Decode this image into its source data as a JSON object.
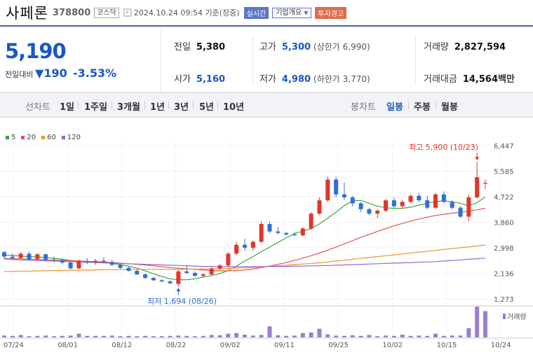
{
  "header": {
    "name": "사페론",
    "code": "378800",
    "market": "코스닥",
    "datetime": "2024.10.24 09:54 기준(장중)",
    "badge_realtime": "실시간",
    "badge_company": "기업개요",
    "badge_warning": "투자경고"
  },
  "price": {
    "current": "5,190",
    "change_label": "전일대비",
    "change_amount": "190",
    "change_pct": "-3.53%",
    "color_down": "#1a56c8",
    "color_up": "#e0362c"
  },
  "stats": {
    "prev_label": "전일",
    "prev": "5,380",
    "open_label": "시가",
    "open": "5,160",
    "high_label": "고가",
    "high": "5,300",
    "upper_limit": "(상한가 6,990)",
    "low_label": "저가",
    "low": "4,980",
    "lower_limit": "(하한가 3,770)",
    "volume_label": "거래량",
    "volume": "2,827,594",
    "amount_label": "거래대금",
    "amount": "14,564",
    "amount_unit": "백만"
  },
  "toolbar": {
    "line_label": "선차트",
    "line_periods": [
      "1일",
      "1주일",
      "3개월",
      "1년",
      "3년",
      "5년",
      "10년"
    ],
    "candle_label": "봉차트",
    "candle_periods": [
      "일봉",
      "주봉",
      "월봉"
    ],
    "active_candle": "일봉"
  },
  "chart_data": {
    "type": "candlestick",
    "legend": [
      {
        "name": "5",
        "color": "#3fa53f"
      },
      {
        "name": "20",
        "color": "#e05555"
      },
      {
        "name": "60",
        "color": "#e8962e"
      },
      {
        "name": "120",
        "color": "#9966cc"
      }
    ],
    "y_ticks": [
      "6,447",
      "5,585",
      "4,722",
      "3,860",
      "2,998",
      "2,136",
      "1,273"
    ],
    "x_ticks": [
      "07/24",
      "08/01",
      "08/12",
      "08/22",
      "09/02",
      "09/11",
      "09/25",
      "10/02",
      "10/15",
      "10/24"
    ],
    "annotation_high": "최고 5,900 (10/23)",
    "annotation_low": "최저 1,694 (08/26)",
    "volume_label": "거래량",
    "candles": [
      [
        2850,
        2900,
        2620,
        2700
      ],
      [
        2700,
        2800,
        2600,
        2650
      ],
      [
        2650,
        2850,
        2620,
        2800
      ],
      [
        2800,
        2860,
        2560,
        2620
      ],
      [
        2620,
        2820,
        2580,
        2780
      ],
      [
        2780,
        2800,
        2560,
        2600
      ],
      [
        2600,
        2700,
        2500,
        2580
      ],
      [
        2580,
        2650,
        2450,
        2500
      ],
      [
        2500,
        2550,
        2280,
        2300
      ],
      [
        2300,
        2600,
        2280,
        2550
      ],
      [
        2550,
        2650,
        2450,
        2500
      ],
      [
        2500,
        2620,
        2420,
        2560
      ],
      [
        2560,
        2680,
        2480,
        2520
      ],
      [
        2520,
        2600,
        2380,
        2420
      ],
      [
        2420,
        2460,
        2280,
        2320
      ],
      [
        2320,
        2360,
        2200,
        2220
      ],
      [
        2220,
        2260,
        2080,
        2100
      ],
      [
        2100,
        2140,
        1950,
        1980
      ],
      [
        1980,
        2020,
        1880,
        1900
      ],
      [
        1900,
        1940,
        1840,
        1860
      ],
      [
        1860,
        1900,
        1780,
        1800
      ],
      [
        1780,
        2250,
        1694,
        2200
      ],
      [
        2200,
        2400,
        2100,
        2150
      ],
      [
        2150,
        2200,
        2020,
        2050
      ],
      [
        2050,
        2150,
        1980,
        2100
      ],
      [
        2100,
        2350,
        2050,
        2300
      ],
      [
        2300,
        2450,
        2250,
        2400
      ],
      [
        2400,
        2850,
        2350,
        2800
      ],
      [
        2800,
        3200,
        2750,
        3100
      ],
      [
        3100,
        3300,
        2900,
        3000
      ],
      [
        3000,
        3250,
        2900,
        3200
      ],
      [
        3200,
        3900,
        3150,
        3800
      ],
      [
        3800,
        3880,
        3500,
        3550
      ],
      [
        3550,
        3700,
        3450,
        3500
      ],
      [
        3500,
        3520,
        3400,
        3450
      ],
      [
        3450,
        3520,
        3380,
        3420
      ],
      [
        3420,
        3700,
        3380,
        3650
      ],
      [
        3650,
        4200,
        3600,
        4150
      ],
      [
        4150,
        4700,
        4100,
        4600
      ],
      [
        4600,
        5400,
        4550,
        5300
      ],
      [
        5300,
        5400,
        4700,
        4800
      ],
      [
        4800,
        5200,
        4600,
        4700
      ],
      [
        4700,
        4750,
        4400,
        4500
      ],
      [
        4500,
        4550,
        4200,
        4300
      ],
      [
        4300,
        4350,
        4100,
        4150
      ],
      [
        4150,
        4300,
        4000,
        4250
      ],
      [
        4250,
        4650,
        4200,
        4600
      ],
      [
        4600,
        4700,
        4350,
        4400
      ],
      [
        4400,
        4600,
        4350,
        4550
      ],
      [
        4550,
        4800,
        4500,
        4750
      ],
      [
        4750,
        4850,
        4550,
        4600
      ],
      [
        4600,
        4750,
        4300,
        4350
      ],
      [
        4350,
        4850,
        4300,
        4800
      ],
      [
        4800,
        4900,
        4500,
        4550
      ],
      [
        4550,
        4600,
        4300,
        4350
      ],
      [
        4350,
        4400,
        4000,
        4050
      ],
      [
        4050,
        4800,
        3900,
        4700
      ],
      [
        4700,
        5900,
        4650,
        5380
      ],
      [
        5160,
        5300,
        4980,
        5190
      ]
    ],
    "ma5": [
      2750,
      2740,
      2720,
      2700,
      2690,
      2670,
      2640,
      2610,
      2570,
      2550,
      2530,
      2520,
      2500,
      2470,
      2430,
      2380,
      2310,
      2220,
      2120,
      2030,
      1950,
      1920,
      1920,
      1950,
      2010,
      2060,
      2130,
      2230,
      2380,
      2550,
      2700,
      2870,
      3020,
      3180,
      3330,
      3480,
      3560,
      3650,
      3800,
      4000,
      4200,
      4420,
      4580,
      4600,
      4500,
      4400,
      4350,
      4330,
      4330,
      4370,
      4440,
      4500,
      4560,
      4580,
      4550,
      4500,
      4420,
      4520,
      4720
    ],
    "ma20": [
      2640,
      2630,
      2620,
      2610,
      2600,
      2590,
      2580,
      2570,
      2560,
      2550,
      2540,
      2530,
      2520,
      2500,
      2480,
      2460,
      2440,
      2420,
      2390,
      2360,
      2330,
      2310,
      2290,
      2270,
      2250,
      2230,
      2220,
      2220,
      2230,
      2250,
      2280,
      2330,
      2380,
      2440,
      2500,
      2570,
      2650,
      2730,
      2820,
      2920,
      3020,
      3130,
      3240,
      3350,
      3450,
      3550,
      3650,
      3740,
      3820,
      3900,
      3970,
      4030,
      4090,
      4130,
      4170,
      4200,
      4230,
      4280,
      4330
    ],
    "ma60": [
      2200,
      2200,
      2210,
      2210,
      2220,
      2220,
      2230,
      2230,
      2240,
      2240,
      2250,
      2250,
      2260,
      2260,
      2260,
      2270,
      2270,
      2270,
      2270,
      2270,
      2270,
      2270,
      2280,
      2280,
      2280,
      2290,
      2290,
      2300,
      2310,
      2320,
      2330,
      2350,
      2370,
      2390,
      2410,
      2430,
      2450,
      2470,
      2490,
      2520,
      2550,
      2580,
      2610,
      2640,
      2670,
      2700,
      2730,
      2760,
      2790,
      2820,
      2850,
      2880,
      2910,
      2940,
      2970,
      3000,
      3030,
      3060,
      3090
    ],
    "ma120": [
      2620,
      2600,
      2590,
      2580,
      2570,
      2560,
      2550,
      2540,
      2530,
      2520,
      2510,
      2500,
      2490,
      2480,
      2470,
      2460,
      2450,
      2440,
      2430,
      2420,
      2410,
      2400,
      2390,
      2380,
      2370,
      2370,
      2360,
      2360,
      2360,
      2360,
      2360,
      2360,
      2370,
      2370,
      2370,
      2380,
      2380,
      2390,
      2390,
      2400,
      2410,
      2420,
      2430,
      2440,
      2450,
      2460,
      2470,
      2480,
      2490,
      2500,
      2510,
      2520,
      2530,
      2550,
      2570,
      2590,
      2610,
      2630,
      2650
    ],
    "volumes": [
      6,
      5,
      8,
      4,
      5,
      6,
      4,
      5,
      6,
      12,
      5,
      5,
      5,
      6,
      4,
      5,
      4,
      5,
      4,
      4,
      5,
      6,
      5,
      4,
      5,
      8,
      7,
      12,
      14,
      9,
      6,
      8,
      36,
      7,
      5,
      6,
      14,
      16,
      28,
      10,
      6,
      5,
      7,
      5,
      8,
      4,
      6,
      5,
      9,
      5,
      6,
      5,
      12,
      5,
      6,
      6,
      30,
      100,
      85
    ]
  }
}
